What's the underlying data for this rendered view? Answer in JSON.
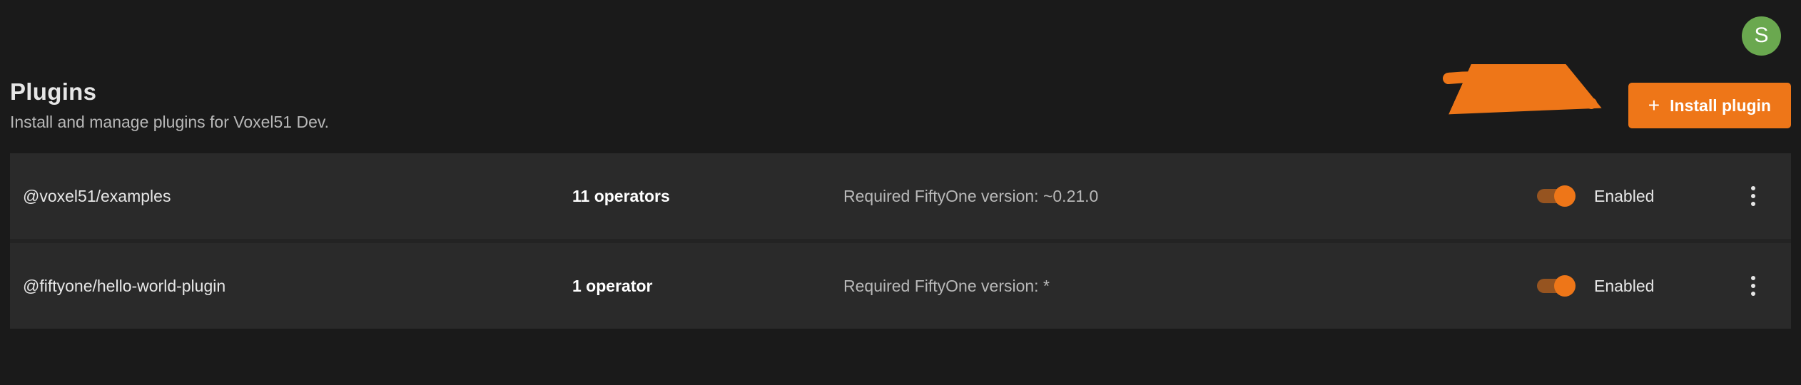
{
  "topbar": {
    "avatar_letter": "S"
  },
  "header": {
    "title": "Plugins",
    "subtitle": "Install and manage plugins for Voxel51 Dev.",
    "install_button_label": "Install plugin"
  },
  "required_prefix": "Required FiftyOne version: ",
  "status_enabled": "Enabled",
  "plugins": [
    {
      "name": "@voxel51/examples",
      "operators": "11 operators",
      "required_version": "~0.21.0",
      "enabled": true
    },
    {
      "name": "@fiftyone/hello-world-plugin",
      "operators": "1 operator",
      "required_version": "*",
      "enabled": true
    }
  ],
  "colors": {
    "accent": "#ee7618"
  }
}
